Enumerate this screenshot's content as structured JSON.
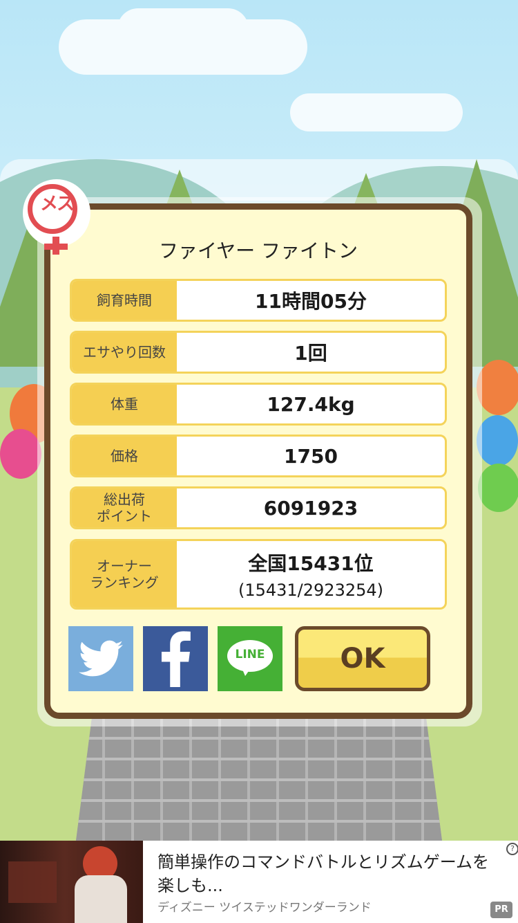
{
  "dialog": {
    "gender_badge": "メス",
    "pet_name": "ファイヤー ファイトン",
    "stats": [
      {
        "label": "飼育時間",
        "value": "11時間05分"
      },
      {
        "label": "エサやり回数",
        "value": "1回"
      },
      {
        "label": "体重",
        "value": "127.4kg"
      },
      {
        "label": "価格",
        "value": "1750"
      },
      {
        "label": "総出荷\nポイント",
        "value": "6091923"
      }
    ],
    "ranking": {
      "label": "オーナー\nランキング",
      "value": "全国15431位",
      "detail": "(15431/2923254)"
    },
    "share": {
      "twitter": "twitter-icon",
      "facebook": "facebook-icon",
      "line_label": "LINE"
    },
    "ok_label": "OK"
  },
  "ad": {
    "title": "簡単操作のコマンドバトルとリズムゲームを楽しも...",
    "sponsor": "ディズニー ツイステッドワンダーランド",
    "pr_label": "PR",
    "info_icon": "?"
  },
  "colors": {
    "frame": "#6b4a2b",
    "panel": "#fffbd0",
    "label_bg": "#f5cf52",
    "twitter": "#7aaedc",
    "facebook": "#3b5a9a",
    "line": "#45b035",
    "badge": "#e24d52"
  }
}
